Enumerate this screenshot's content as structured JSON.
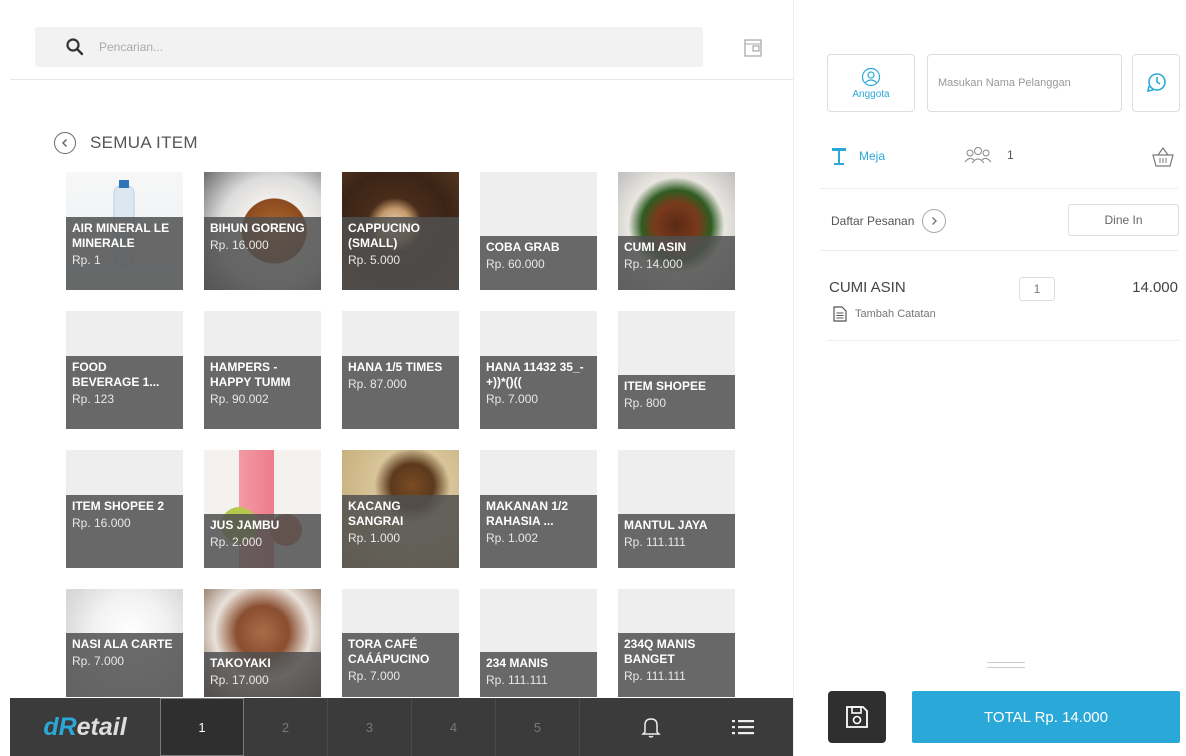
{
  "search": {
    "placeholder": "Pencarian..."
  },
  "section": {
    "title": "SEMUA ITEM"
  },
  "items": [
    {
      "name": "AIR MINERAL LE MINERALE",
      "price": "Rp. 1"
    },
    {
      "name": "BIHUN GORENG",
      "price": "Rp. 16.000"
    },
    {
      "name": "CAPPUCINO (SMALL)",
      "price": "Rp. 5.000"
    },
    {
      "name": "COBA GRAB",
      "price": "Rp. 60.000"
    },
    {
      "name": "CUMI ASIN",
      "price": "Rp. 14.000"
    },
    {
      "name": "FOOD BEVERAGE 1...",
      "price": "Rp. 123"
    },
    {
      "name": "HAMPERS - HAPPY TUMM",
      "price": "Rp. 90.002"
    },
    {
      "name": "HANA 1/5 TIMES",
      "price": "Rp. 87.000"
    },
    {
      "name": "HANA 11432 35_-+))*()((",
      "price": "Rp. 7.000"
    },
    {
      "name": "ITEM SHOPEE",
      "price": "Rp. 800"
    },
    {
      "name": "ITEM SHOPEE 2",
      "price": "Rp. 16.000"
    },
    {
      "name": "JUS JAMBU",
      "price": "Rp. 2.000"
    },
    {
      "name": "KACANG SANGRAI",
      "price": "Rp. 1.000"
    },
    {
      "name": "MAKANAN 1/2 RAHASIA ...",
      "price": "Rp. 1.002"
    },
    {
      "name": "MANTUL JAYA",
      "price": "Rp. 111.111"
    },
    {
      "name": "NASI ALA CARTE",
      "price": "Rp. 7.000"
    },
    {
      "name": "TAKOYAKI",
      "price": "Rp. 17.000"
    },
    {
      "name": "TORA CAFÉ CAÁÁPUCINO",
      "price": "Rp. 7.000"
    },
    {
      "name": "234 MANIS",
      "price": "Rp. 111.111"
    },
    {
      "name": "234Q MANIS BANGET",
      "price": "Rp. 111.111"
    }
  ],
  "bottom_bar": {
    "logo_d": "d",
    "logo_r": "R",
    "logo_rest": "etail",
    "tabs": [
      "1",
      "2",
      "3",
      "4",
      "5"
    ],
    "active_tab": "1"
  },
  "customer": {
    "member_label": "Anggota",
    "name_placeholder": "Masukan Nama Pelanggan"
  },
  "table": {
    "label": "Meja",
    "guests": "1"
  },
  "order": {
    "list_label": "Daftar Pesanan",
    "type": "Dine In",
    "lines": [
      {
        "name": "CUMI ASIN",
        "qty": "1",
        "price": "14.000",
        "note": "Tambah Catatan"
      }
    ]
  },
  "total": {
    "label": "TOTAL Rp. 14.000"
  },
  "colors": {
    "accent": "#2aa9d8",
    "bar": "#3b3b3b"
  }
}
